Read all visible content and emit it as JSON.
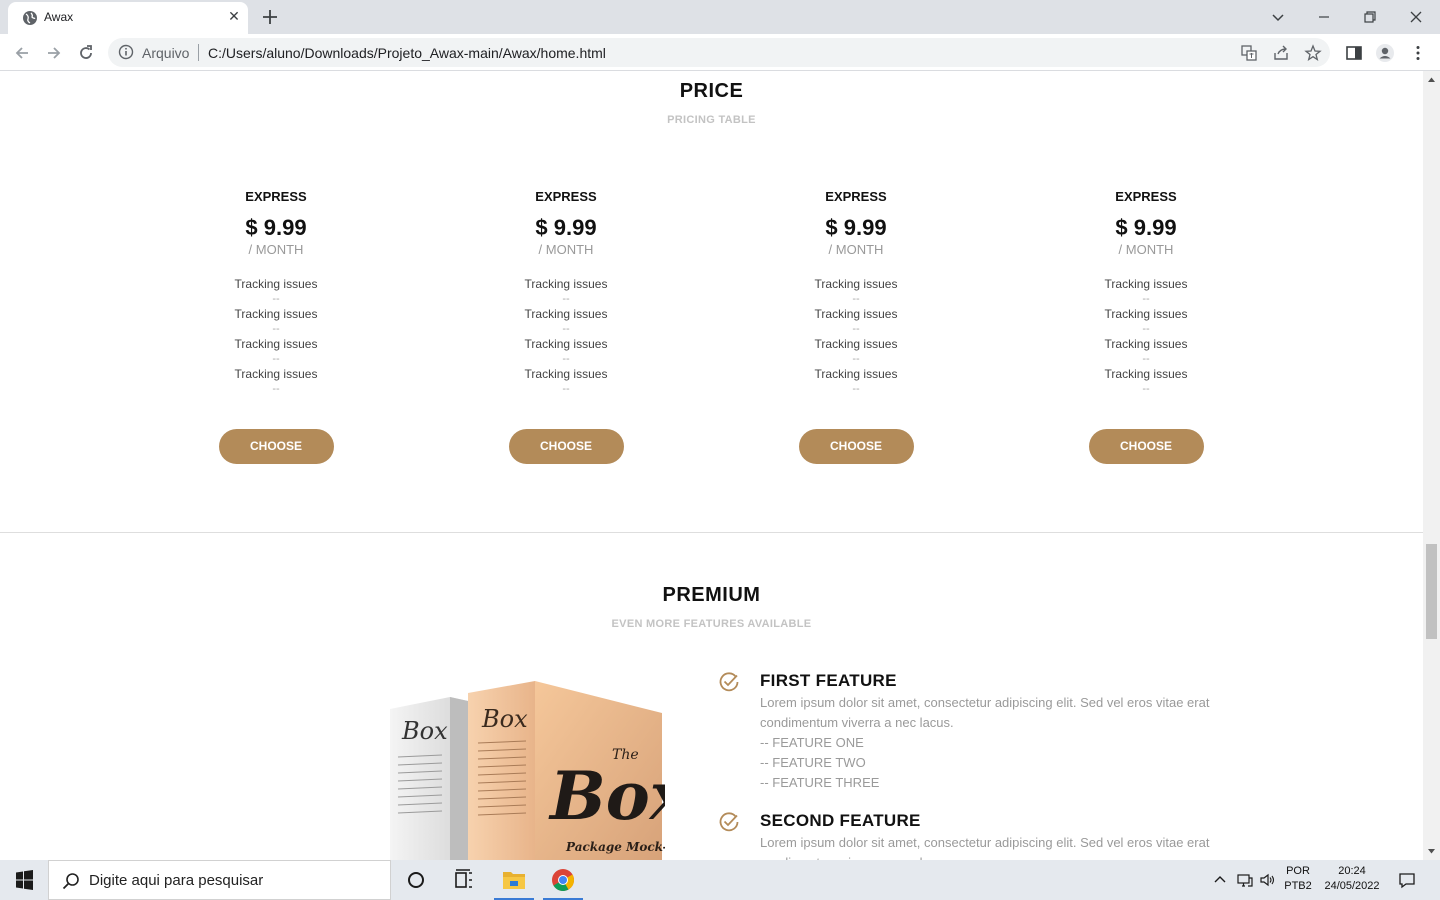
{
  "browser": {
    "tab_title": "Awax",
    "omnibox_label": "Arquivo",
    "url": "C:/Users/aluno/Downloads/Projeto_Awax-main/Awax/home.html"
  },
  "price_section": {
    "title": "PRICE",
    "subtitle": "PRICING TABLE",
    "plans": [
      {
        "name": "EXPRESS",
        "price": "$ 9.99",
        "period": "/ MONTH",
        "features": [
          "Tracking issues",
          "Tracking issues",
          "Tracking issues",
          "Tracking issues"
        ],
        "dash": "--",
        "button": "CHOOSE"
      },
      {
        "name": "EXPRESS",
        "price": "$ 9.99",
        "period": "/ MONTH",
        "features": [
          "Tracking issues",
          "Tracking issues",
          "Tracking issues",
          "Tracking issues"
        ],
        "dash": "--",
        "button": "CHOOSE"
      },
      {
        "name": "EXPRESS",
        "price": "$ 9.99",
        "period": "/ MONTH",
        "features": [
          "Tracking issues",
          "Tracking issues",
          "Tracking issues",
          "Tracking issues"
        ],
        "dash": "--",
        "button": "CHOOSE"
      },
      {
        "name": "EXPRESS",
        "price": "$ 9.99",
        "period": "/ MONTH",
        "features": [
          "Tracking issues",
          "Tracking issues",
          "Tracking issues",
          "Tracking issues"
        ],
        "dash": "--",
        "button": "CHOOSE"
      }
    ]
  },
  "premium_section": {
    "title": "PREMIUM",
    "subtitle": "EVEN MORE FEATURES AVAILABLE",
    "box_image": {
      "front_brand": "Box",
      "front_prefix": "The",
      "front_caption": "Package Mock-Up",
      "back_brand": "Box"
    },
    "features": [
      {
        "title": "FIRST FEATURE",
        "body": "Lorem ipsum dolor sit amet, consectetur adipiscing elit. Sed vel eros vitae erat condimentum viverra a nec lacus.",
        "items": [
          "-- FEATURE ONE",
          "-- FEATURE TWO",
          "-- FEATURE THREE"
        ]
      },
      {
        "title": "SECOND FEATURE",
        "body": "Lorem ipsum dolor sit amet, consectetur adipiscing elit. Sed vel eros vitae erat condimentum viverra a nec lacus."
      }
    ]
  },
  "taskbar": {
    "search_placeholder": "Digite aqui para pesquisar",
    "language_top": "POR",
    "language_bottom": "PTB2",
    "time": "20:24",
    "date": "24/05/2022"
  },
  "colors": {
    "accent": "#b38b59",
    "heading": "#111111",
    "muted": "#9a9a9a"
  }
}
